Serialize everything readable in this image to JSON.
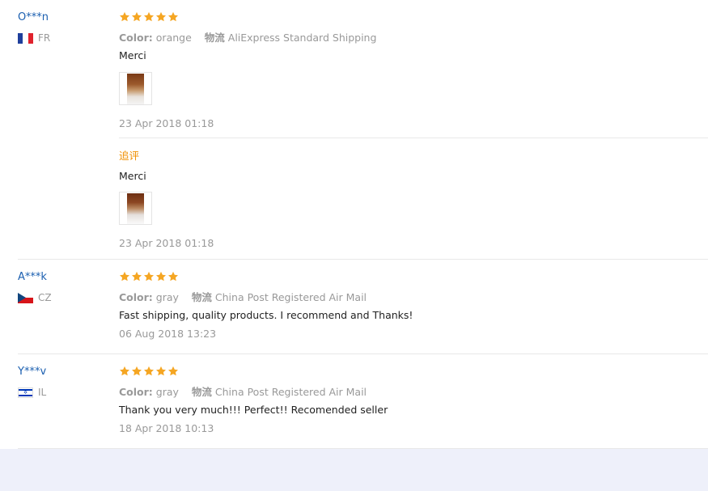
{
  "colors": {
    "star": "#f5a623",
    "username": "#1b5fb0",
    "followup": "#f08f00",
    "meta": "#999999",
    "text": "#222222",
    "footer_bg": "#eef0fa"
  },
  "reviews": [
    {
      "user": "O***n",
      "country_code": "FR",
      "flag": "france-flag-icon",
      "rating": 5,
      "color_label": "Color:",
      "color_value": "orange",
      "logistics_label": "物流",
      "logistics_value": "AliExpress Standard Shipping",
      "text": "Merci",
      "date": "23 Apr 2018 01:18",
      "followup": {
        "label": "追评",
        "text": "Merci",
        "date": "23 Apr 2018 01:18"
      }
    },
    {
      "user": "A***k",
      "country_code": "CZ",
      "flag": "czech-flag-icon",
      "rating": 5,
      "color_label": "Color:",
      "color_value": "gray",
      "logistics_label": "物流",
      "logistics_value": "China Post Registered Air Mail",
      "text": "Fast shipping, quality products. I recommend and Thanks!",
      "date": "06 Aug 2018 13:23"
    },
    {
      "user": "Y***v",
      "country_code": "IL",
      "flag": "israel-flag-icon",
      "rating": 5,
      "color_label": "Color:",
      "color_value": "gray",
      "logistics_label": "物流",
      "logistics_value": "China Post Registered Air Mail",
      "text": "Thank you very much!!! Perfect!! Recomended seller",
      "date": "18 Apr 2018 10:13"
    }
  ]
}
